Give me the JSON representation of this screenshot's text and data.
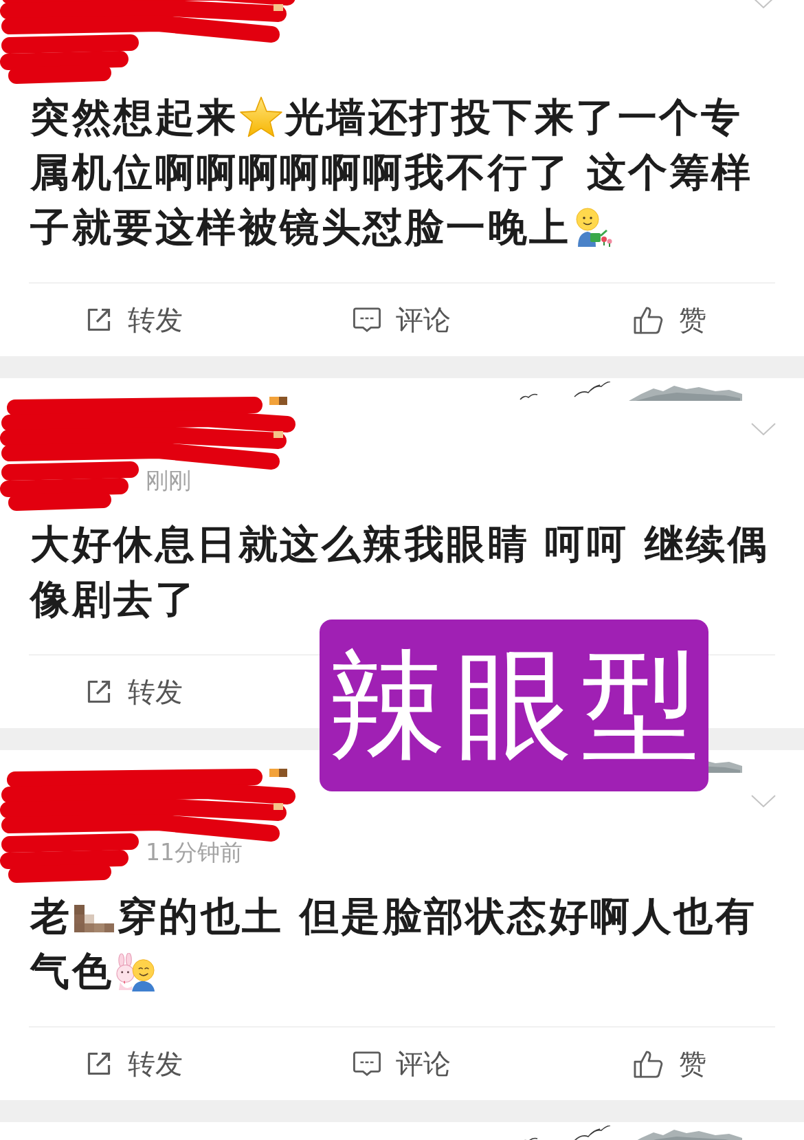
{
  "posts": [
    {
      "author_redacted": true,
      "decoration": false,
      "content": [
        {
          "kind": "text",
          "text": "突然想起来"
        },
        {
          "kind": "star"
        },
        {
          "kind": "text",
          "text": "光墙还打投下来了一个专属机位啊啊啊啊啊啊我不行了 这个筹样子就要这样被镜头怼脸一晚上"
        },
        {
          "kind": "gardener"
        }
      ],
      "actions": [
        {
          "kind": "repost",
          "label": "转发"
        },
        {
          "kind": "comment",
          "label": "评论"
        },
        {
          "kind": "like",
          "label": "赞"
        }
      ]
    },
    {
      "author_redacted": true,
      "decoration": true,
      "timestamp": "刚刚",
      "content": [
        {
          "kind": "text",
          "text": "大好休息日就这么辣我眼睛 呵呵 继续偶像剧去了"
        }
      ],
      "actions": [
        {
          "kind": "repost",
          "label": "转发"
        }
      ]
    },
    {
      "author_redacted": true,
      "decoration": true,
      "timestamp": "11分钟前",
      "content": [
        {
          "kind": "text",
          "text": "老"
        },
        {
          "kind": "mosaic"
        },
        {
          "kind": "text",
          "text": "穿的也土 但是脸部状态好啊人也有气色"
        },
        {
          "kind": "hug"
        }
      ],
      "actions": [
        {
          "kind": "repost",
          "label": "转发"
        },
        {
          "kind": "comment",
          "label": "评论"
        },
        {
          "kind": "like",
          "label": "赞"
        }
      ]
    }
  ],
  "next_card": {
    "decoration": true
  },
  "sticker": {
    "text": "辣眼型"
  }
}
